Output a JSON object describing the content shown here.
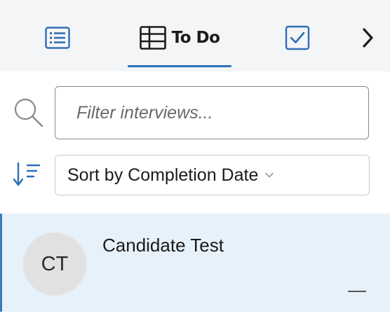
{
  "tabs": {
    "list_icon": "list-icon",
    "todo": {
      "icon": "table-icon",
      "label": "To Do"
    },
    "done_icon": "checkbox-checked-icon",
    "next_icon": "chevron-right-icon"
  },
  "filter": {
    "placeholder": "Filter interviews...",
    "value": ""
  },
  "sort": {
    "label": "Sort by Completion Date",
    "icon": "sort-descending-icon"
  },
  "items": [
    {
      "initials": "CT",
      "name": "Candidate Test",
      "status": "—"
    }
  ],
  "colors": {
    "accent": "#2f6fb3",
    "tabbar_bg": "#f4f5f7",
    "selected_bg": "#e7f1fa",
    "avatar_bg": "#e1e1e1"
  }
}
